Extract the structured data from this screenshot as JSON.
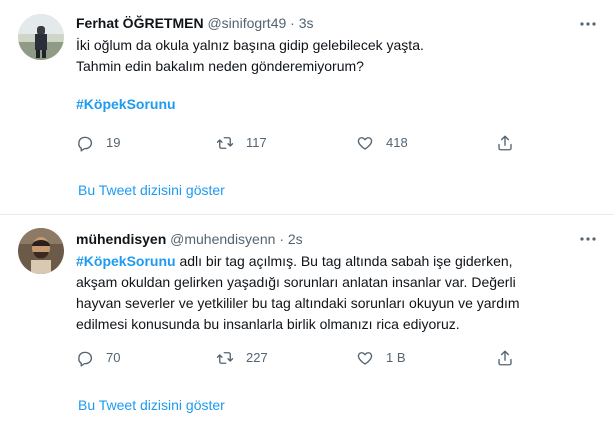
{
  "tweets": [
    {
      "author_name": "Ferhat ÖĞRETMEN",
      "handle": "@sinifogrt49",
      "separator": "·",
      "time": "3s",
      "lines": [
        "İki oğlum da okula yalnız başına gidip gelebilecek yaşta.",
        "Tahmin edin bakalım neden gönderemiyorum?"
      ],
      "hashtag": "#KöpekSorunu",
      "replies": "19",
      "retweets": "117",
      "likes": "418",
      "thread_link": "Bu Tweet dizisini göster"
    },
    {
      "author_name": "mühendisyen",
      "handle": "@muhendisyenn",
      "separator": "·",
      "time": "2s",
      "hashtag": "#KöpekSorunu",
      "first_line_rest": " adlı bir tag açılmış. Bu tag altında sabah işe giderken,",
      "lines": [
        "akşam okuldan gelirken yaşadığı sorunları anlatan insanlar var. Değerli",
        "hayvan severler ve yetkililer bu tag altındaki sorunları okuyun ve yardım",
        "edilmesi konusunda bu insanlarla birlik olmanızı rica ediyoruz."
      ],
      "replies": "70",
      "retweets": "227",
      "likes": "1 B",
      "thread_link": "Bu Tweet dizisini göster"
    }
  ],
  "colors": {
    "accent": "#1d9bf0",
    "muted": "#536471",
    "text": "#0f1419",
    "divider": "#e6ecf0"
  },
  "icons": [
    "reply-icon",
    "retweet-icon",
    "like-icon",
    "share-icon",
    "more-icon"
  ]
}
